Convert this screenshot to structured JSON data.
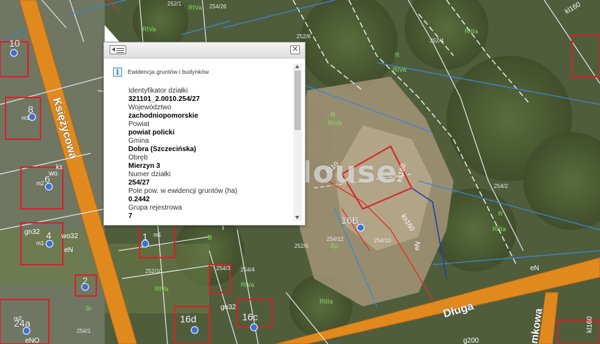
{
  "map": {
    "streets": {
      "ksiezycowa": "Księżycowa",
      "dluga": "Długa",
      "mkowa": "mkowa"
    },
    "building_numbers": [
      "10",
      "8",
      "6",
      "4",
      "2",
      "1",
      "24a",
      "16d",
      "16c",
      "16B"
    ],
    "road_codes": {
      "ks": "ks",
      "wo32": "wo32",
      "gn32": "gn32",
      "ks160": "ks160",
      "k110": "k110",
      "kl160": "kl160",
      "wo": "wo",
      "eN": "eN",
      "eNO": "eNO",
      "g200": "g200"
    },
    "parcel_numbers": [
      "252/1",
      "252/6",
      "252/4",
      "252/5",
      "252/10",
      "254/2",
      "254/3",
      "254/4",
      "254/1",
      "254/10",
      "254/12",
      "254/26",
      "254/33",
      "254/24",
      "254/22",
      "2/7",
      "256/1",
      "253/1"
    ],
    "land_classes": [
      "RIVa",
      "RIIIa",
      "R",
      "RIVb",
      "B",
      "Br",
      "Bp",
      "PsV"
    ],
    "building_labels": [
      "m1",
      "m2"
    ],
    "colors": {
      "parcel_boundary": "#e6e6e6",
      "utility_line": "#3b86d8",
      "building_outline": "#d8202a",
      "land_class_label": "#7ee05a",
      "street": "#e08a1e"
    }
  },
  "watermark": "Lex House",
  "popup": {
    "layer_title": "Ewidencja gruntów i budynków",
    "fields": [
      {
        "label": "Identyfikator działki",
        "value": "321101_2.0010.254/27"
      },
      {
        "label": "Województwo",
        "value": "zachodniopomorskie"
      },
      {
        "label": "Powiat",
        "value": "powiat policki"
      },
      {
        "label": "Gmina",
        "value": "Dobra (Szczecińska)"
      },
      {
        "label": "Obręb",
        "value": "Mierzyn 3"
      },
      {
        "label": "Numer działki",
        "value": "254/27"
      },
      {
        "label": "Pole pow. w ewidencji gruntów (ha)",
        "value": "0.2442"
      },
      {
        "label": "Grupa rejestrowa",
        "value": "7"
      }
    ],
    "close_glyph": "✕",
    "menu_icon": "list-back-icon",
    "info_icon_glyph": "i"
  }
}
